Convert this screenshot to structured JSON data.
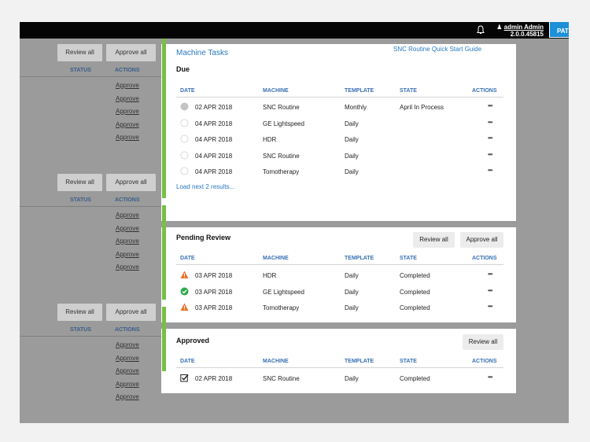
{
  "topbar": {
    "user_name": "admin Admin",
    "version": "2.0.0.45815",
    "patient_tab": "PAT"
  },
  "background": {
    "review_all": "Review all",
    "approve_all": "Approve all",
    "status_header": "STATUS",
    "actions_header": "ACTIONS",
    "approve_link": "Approve"
  },
  "card": {
    "title": "Machine Tasks",
    "guide_link": "SNC Routine Quick Start Guide",
    "columns": {
      "date": "DATE",
      "machine": "MACHINE",
      "template": "TEMPLATE",
      "state": "STATE",
      "actions": "ACTIONS"
    },
    "due": {
      "title": "Due",
      "load_next": "Load next 2 results...",
      "rows": [
        {
          "date": "02 APR 2018",
          "machine": "SNC Routine",
          "template": "Monthly",
          "state": "April In Process",
          "status": "in-process"
        },
        {
          "date": "04 APR 2018",
          "machine": "GE Lightspeed",
          "template": "Daily",
          "state": "",
          "status": "empty"
        },
        {
          "date": "04 APR 2018",
          "machine": "HDR",
          "template": "Daily",
          "state": "",
          "status": "empty"
        },
        {
          "date": "04 APR 2018",
          "machine": "SNC Routine",
          "template": "Daily",
          "state": "",
          "status": "empty"
        },
        {
          "date": "04 APR 2018",
          "machine": "Tomotherapy",
          "template": "Daily",
          "state": "",
          "status": "empty"
        }
      ]
    },
    "pending": {
      "title": "Pending Review",
      "review_all": "Review all",
      "approve_all": "Approve all",
      "rows": [
        {
          "date": "03 APR 2018",
          "machine": "HDR",
          "template": "Daily",
          "state": "Completed",
          "status": "warning"
        },
        {
          "date": "03 APR 2018",
          "machine": "GE Lightspeed",
          "template": "Daily",
          "state": "Completed",
          "status": "ok"
        },
        {
          "date": "03 APR 2018",
          "machine": "Tomotherapy",
          "template": "Daily",
          "state": "Completed",
          "status": "warning"
        }
      ]
    },
    "approved": {
      "title": "Approved",
      "review_all": "Review all",
      "rows": [
        {
          "date": "02 APR 2018",
          "machine": "SNC Routine",
          "template": "Daily",
          "state": "Completed",
          "status": "checked"
        }
      ]
    },
    "row_menu": "•••"
  },
  "colors": {
    "accent": "#2a78c2",
    "green": "#76c043",
    "warning": "#e8732a",
    "ok": "#2eaa4a",
    "topbar": "#050505"
  }
}
